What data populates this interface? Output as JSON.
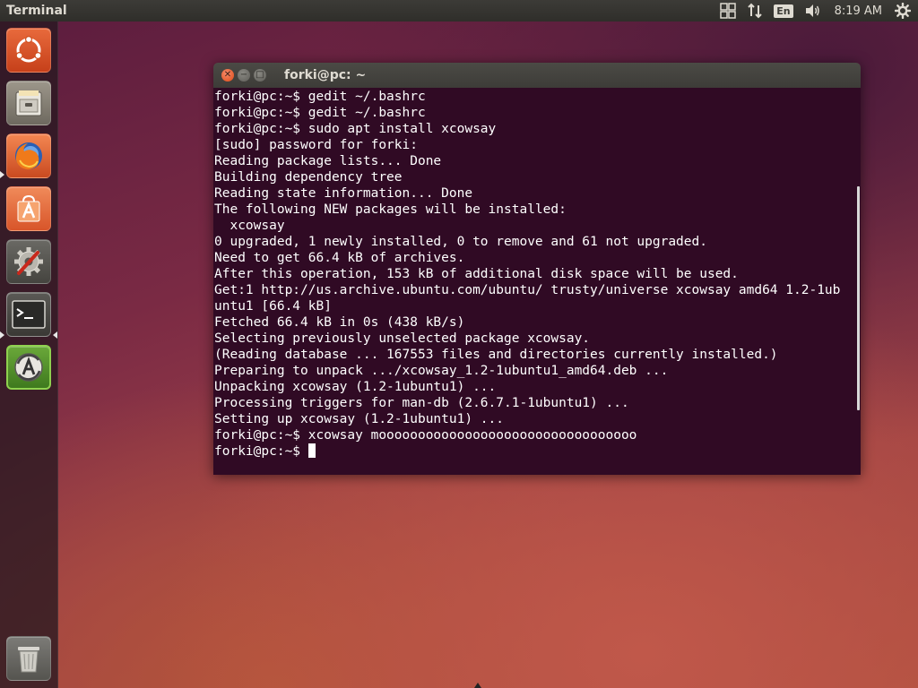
{
  "top_panel": {
    "app_title": "Terminal",
    "lang": "En",
    "time": "8:19 AM",
    "icons": [
      "workspace-switcher-icon",
      "network-icon",
      "keyboard-language-icon",
      "volume-icon",
      "system-gear-icon"
    ]
  },
  "launcher": {
    "items": [
      {
        "name": "ubuntu-dash",
        "color": "#e05a2c"
      },
      {
        "name": "files",
        "color": "#8a8478"
      },
      {
        "name": "firefox",
        "color": "#e8692a"
      },
      {
        "name": "ubuntu-software-center",
        "color": "#e0622a"
      },
      {
        "name": "system-settings",
        "color": "#5e5d58"
      },
      {
        "name": "terminal",
        "color": "#3c3b37"
      },
      {
        "name": "software-updater",
        "color": "#4f8a2a"
      },
      {
        "name": "trash",
        "color": "#7a7a7a"
      }
    ]
  },
  "terminal": {
    "title": "forki@pc: ~",
    "lines": [
      "forki@pc:~$ gedit ~/.bashrc",
      "forki@pc:~$ gedit ~/.bashrc",
      "forki@pc:~$ sudo apt install xcowsay",
      "[sudo] password for forki:",
      "Reading package lists... Done",
      "Building dependency tree",
      "Reading state information... Done",
      "The following NEW packages will be installed:",
      "  xcowsay",
      "0 upgraded, 1 newly installed, 0 to remove and 61 not upgraded.",
      "Need to get 66.4 kB of archives.",
      "After this operation, 153 kB of additional disk space will be used.",
      "Get:1 http://us.archive.ubuntu.com/ubuntu/ trusty/universe xcowsay amd64 1.2-1ub",
      "untu1 [66.4 kB]",
      "Fetched 66.4 kB in 0s (438 kB/s)",
      "Selecting previously unselected package xcowsay.",
      "(Reading database ... 167553 files and directories currently installed.)",
      "Preparing to unpack .../xcowsay_1.2-1ubuntu1_amd64.deb ...",
      "Unpacking xcowsay (1.2-1ubuntu1) ...",
      "Processing triggers for man-db (2.6.7.1-1ubuntu1) ...",
      "Setting up xcowsay (1.2-1ubuntu1) ...",
      "forki@pc:~$ xcowsay mooooooooooooooooooooooooooooooooo"
    ],
    "prompt": "forki@pc:~$ "
  }
}
